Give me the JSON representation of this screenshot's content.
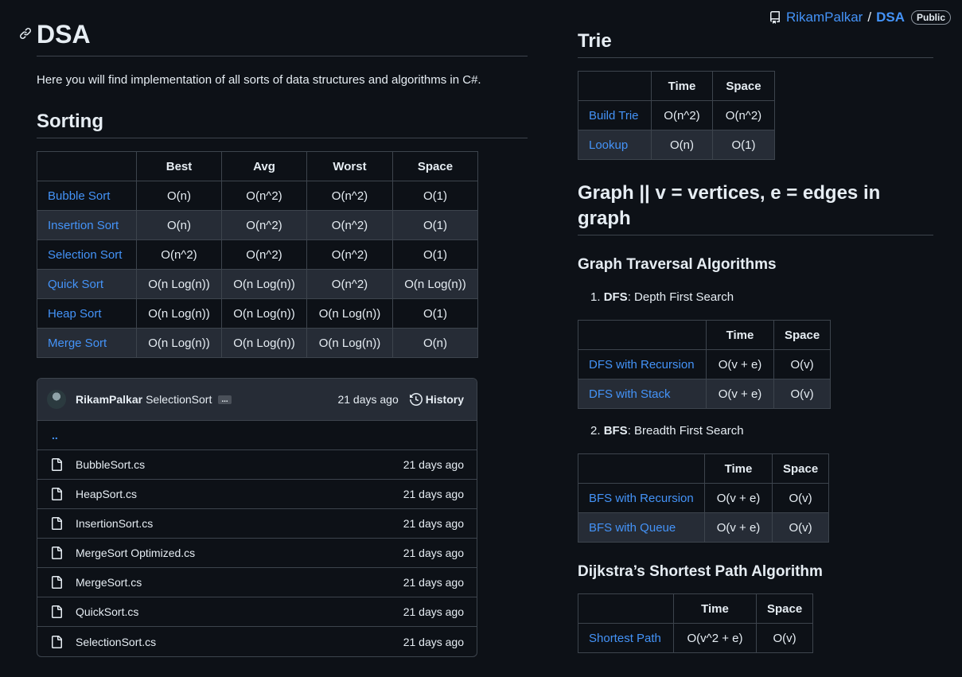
{
  "repo": {
    "owner": "RikamPalkar",
    "separator": "/",
    "name": "DSA",
    "visibility": "Public",
    "icon": "repo-icon"
  },
  "readme": {
    "title": "DSA",
    "description": "Here you will find implementation of all sorts of data structures and algorithms in C#.",
    "sorting": {
      "heading": "Sorting",
      "columns": [
        "",
        "Best",
        "Avg",
        "Worst",
        "Space"
      ],
      "rows": [
        {
          "name": "Bubble Sort",
          "best": "O(n)",
          "avg": "O(n^2)",
          "worst": "O(n^2)",
          "space": "O(1)"
        },
        {
          "name": "Insertion Sort",
          "best": "O(n)",
          "avg": "O(n^2)",
          "worst": "O(n^2)",
          "space": "O(1)"
        },
        {
          "name": "Selection Sort",
          "best": "O(n^2)",
          "avg": "O(n^2)",
          "worst": "O(n^2)",
          "space": "O(1)"
        },
        {
          "name": "Quick Sort",
          "best": "O(n Log(n))",
          "avg": "O(n Log(n))",
          "worst": "O(n^2)",
          "space": "O(n Log(n))"
        },
        {
          "name": "Heap Sort",
          "best": "O(n Log(n))",
          "avg": "O(n Log(n))",
          "worst": "O(n Log(n))",
          "space": "O(1)"
        },
        {
          "name": "Merge Sort",
          "best": "O(n Log(n))",
          "avg": "O(n Log(n))",
          "worst": "O(n Log(n))",
          "space": "O(n)"
        }
      ]
    },
    "trie": {
      "heading": "Trie",
      "columns": [
        "",
        "Time",
        "Space"
      ],
      "rows": [
        {
          "name": "Build Trie",
          "time": "O(n^2)",
          "space": "O(n^2)"
        },
        {
          "name": "Lookup",
          "time": "O(n)",
          "space": "O(1)"
        }
      ]
    },
    "graph": {
      "heading": "Graph || v = vertices, e = edges in graph",
      "traversal_heading": "Graph Traversal Algorithms",
      "dfs": {
        "number": "1.",
        "abbr": "DFS",
        "text": ": Depth First Search",
        "columns": [
          "",
          "Time",
          "Space"
        ],
        "rows": [
          {
            "name": "DFS with Recursion",
            "time": "O(v + e)",
            "space": "O(v)"
          },
          {
            "name": "DFS with Stack",
            "time": "O(v + e)",
            "space": "O(v)"
          }
        ]
      },
      "bfs": {
        "number": "2.",
        "abbr": "BFS",
        "text": ": Breadth First Search",
        "columns": [
          "",
          "Time",
          "Space"
        ],
        "rows": [
          {
            "name": "BFS with Recursion",
            "time": "O(v + e)",
            "space": "O(v)"
          },
          {
            "name": "BFS with Queue",
            "time": "O(v + e)",
            "space": "O(v)"
          }
        ]
      },
      "dijkstra": {
        "heading": "Dijkstra’s Shortest Path Algorithm",
        "columns": [
          "",
          "Time",
          "Space"
        ],
        "rows": [
          {
            "name": "Shortest Path",
            "time": "O(v^2 + e)",
            "space": "O(v)"
          }
        ]
      }
    }
  },
  "file_browser": {
    "commit": {
      "author": "RikamPalkar",
      "message": "SelectionSort",
      "ellipsis": "...",
      "time": "21 days ago",
      "history_label": "History"
    },
    "parent_dir": "..",
    "files": [
      {
        "name": "BubbleSort.cs",
        "time": "21 days ago"
      },
      {
        "name": "HeapSort.cs",
        "time": "21 days ago"
      },
      {
        "name": "InsertionSort.cs",
        "time": "21 days ago"
      },
      {
        "name": "MergeSort Optimized.cs",
        "time": "21 days ago"
      },
      {
        "name": "MergeSort.cs",
        "time": "21 days ago"
      },
      {
        "name": "QuickSort.cs",
        "time": "21 days ago"
      },
      {
        "name": "SelectionSort.cs",
        "time": "21 days ago"
      }
    ]
  },
  "colors": {
    "background": "#0d1117",
    "link": "#4493f8",
    "text": "#e6edf3",
    "border": "#3d444d",
    "alt_row": "#262c36"
  }
}
